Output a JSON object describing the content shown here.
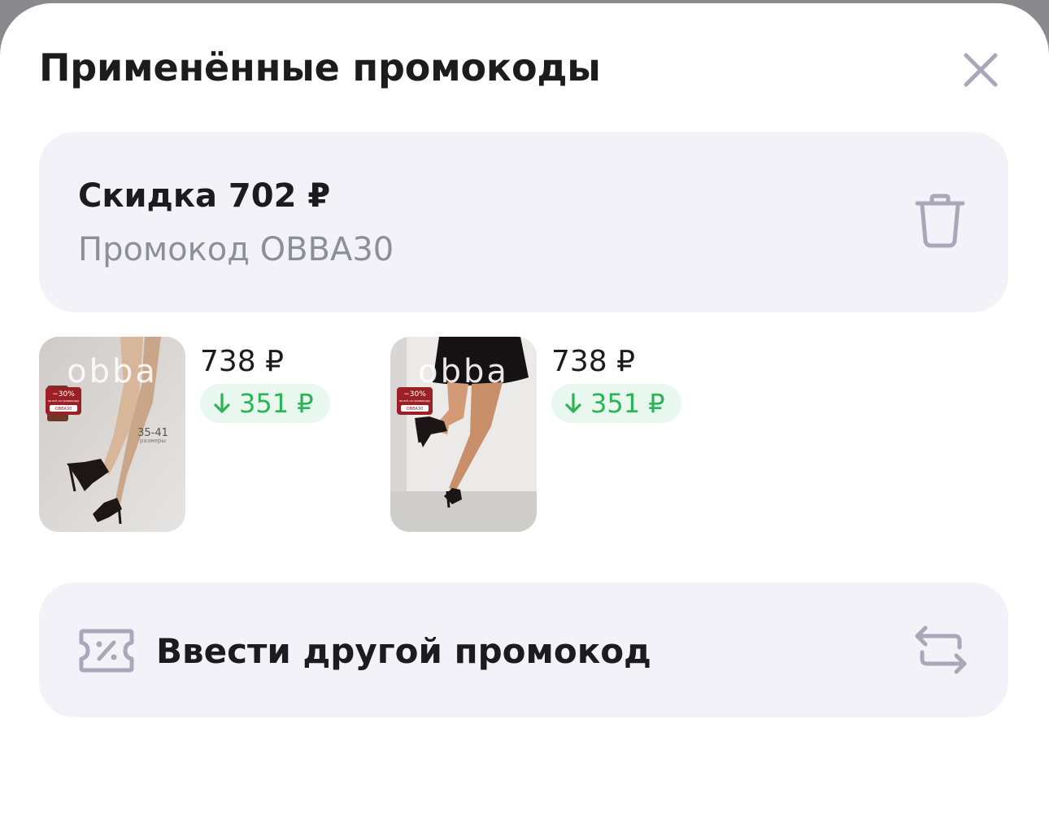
{
  "header": {
    "title": "Применённые промокоды",
    "close_icon": "close-icon"
  },
  "applied_promo": {
    "discount_label": "Скидка 702 ₽",
    "code_label": "Промокод OBBA30",
    "delete_icon": "trash-icon"
  },
  "products": [
    {
      "price": "738 ₽",
      "discount": "351 ₽",
      "brand": "obba",
      "badge_percent": "−30%",
      "badge_line": "на всё по промокоду",
      "badge_code": "OBBA30",
      "sizes": "35-41",
      "sizes_caption": "размеры"
    },
    {
      "price": "738 ₽",
      "discount": "351 ₽",
      "brand": "obba",
      "badge_percent": "−30%",
      "badge_line": "на всё по промокоду",
      "badge_code": "OBBA30"
    }
  ],
  "enter_other": {
    "label": "Ввести другой промокод",
    "coupon_icon": "coupon-percent-icon",
    "swap_icon": "swap-arrows-icon"
  },
  "colors": {
    "card_background": "#f3f2f8",
    "discount_green": "#2bb356",
    "discount_badge_bg": "#e9f8ee",
    "secondary_text": "#8e8e99",
    "icon_gray": "#a9a7b8"
  }
}
